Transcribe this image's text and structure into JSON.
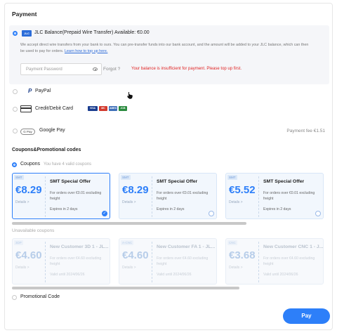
{
  "title": "Payment",
  "jlc": {
    "label": "JLC Balance(Prepaid Wire Transfer) Available: €0.00",
    "logo": "JLC",
    "desc_line1": "We accept direct wire transfers from your bank to ours. You can pre-transfer funds into our bank account, and the amount will be added to your JLC balance, which can then",
    "desc_line2": "be used to pay for orders.",
    "desc_link": "Learn how to top up here.",
    "password_placeholder": "Payment Password",
    "forgot": "Forgot ?",
    "error": "Your balance is insufficient for payment. Please top up first."
  },
  "paypal": {
    "label": "PayPal"
  },
  "card": {
    "label": "Credit/Debit Card",
    "brands": [
      "VISA",
      "MC",
      "AMEX",
      "JCB"
    ]
  },
  "gpay": {
    "badge": "G Pay",
    "label": "Google Pay",
    "fee": "Payment fee €1.51"
  },
  "promo_title": "Coupons&Promotional codes",
  "coupons_label": "Coupons",
  "coupons_count": "You have 4 valid coupons",
  "available": [
    {
      "tag": "SMT",
      "amount": "€8.29",
      "details": "Details >",
      "name": "SMT Special Offer",
      "desc": "For orders over €0.01 excluding freight",
      "expiry": "Expires in 2 days"
    },
    {
      "tag": "SMT",
      "amount": "€8.29",
      "details": "Details >",
      "name": "SMT Special Offer",
      "desc": "For orders over €0.01 excluding freight",
      "expiry": "Expires in 2 days"
    },
    {
      "tag": "SMT",
      "amount": "€5.52",
      "details": "Details >",
      "name": "SMT Special Offer",
      "desc": "For orders over €0.01 excluding freight",
      "expiry": "Expires in 2 days"
    }
  ],
  "unavailable_label": "Unavailable coupons",
  "unavailable": [
    {
      "tag": "3DP",
      "amount": "€4.60",
      "details": "Details >",
      "name": "New Customer 3D 1 - JL...",
      "desc": "For orders over €4.60 excluding freight",
      "expiry": "Valid until 2024/06/26"
    },
    {
      "tag": "A-CNC",
      "amount": "€4.60",
      "details": "Details >",
      "name": "New Customer FA 1 - JL...",
      "desc": "For orders over €4.60 excluding freight",
      "expiry": "Valid until 2024/06/26"
    },
    {
      "tag": "CNC",
      "amount": "€3.68",
      "details": "Details >",
      "name": "New Customer CNC 1 - J...",
      "desc": "For orders over €4.60 excluding freight",
      "expiry": "Valid until 2024/06/26"
    }
  ],
  "promo_code_label": "Promotional Code",
  "pay": "Pay",
  "colors": {
    "accent": "#2d7ff9",
    "error": "#e02424"
  }
}
